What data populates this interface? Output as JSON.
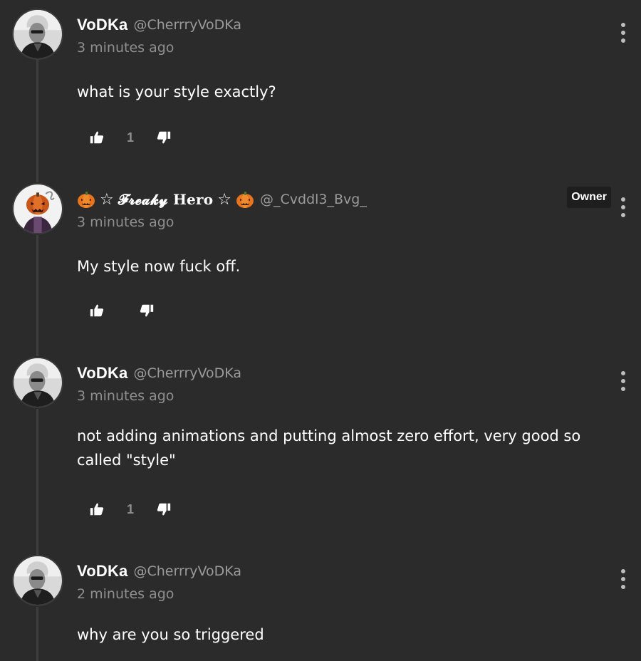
{
  "comments": [
    {
      "name": "VoDKa",
      "handle": "@CherrryVoDKa",
      "time": "3 minutes ago",
      "text": "what is your style exactly?",
      "likes": "1",
      "avatar_icon": "user-avatar-icon"
    },
    {
      "name_prefix_icon": "pumpkin-icon",
      "name_star": "☆",
      "name": "𝓕𝓻𝓮𝓪𝓴𝔂 Hero",
      "name_suffix_icon": "pumpkin-icon",
      "handle": "@_Cvddl3_Bvg_",
      "badge": "Owner",
      "time": "3 minutes ago",
      "text": "My style now fuck off.",
      "avatar_icon": "pumpkin-avatar-icon"
    },
    {
      "name": "VoDKa",
      "handle": "@CherrryVoDKa",
      "time": "3 minutes ago",
      "text": "not adding animations and putting almost zero effort, very good so called \"style\"",
      "likes": "1",
      "avatar_icon": "user-avatar-icon"
    },
    {
      "name": "VoDKa",
      "handle": "@CherrryVoDKa",
      "time": "2 minutes ago",
      "text": "why are you so triggered",
      "avatar_icon": "user-avatar-icon"
    }
  ],
  "colors": {
    "background": "#2b2b2b",
    "thread_line": "#3e3e3e",
    "muted_text": "#8f8f8f",
    "badge_bg": "#1e1e1e",
    "pumpkin": "#e8741c"
  }
}
